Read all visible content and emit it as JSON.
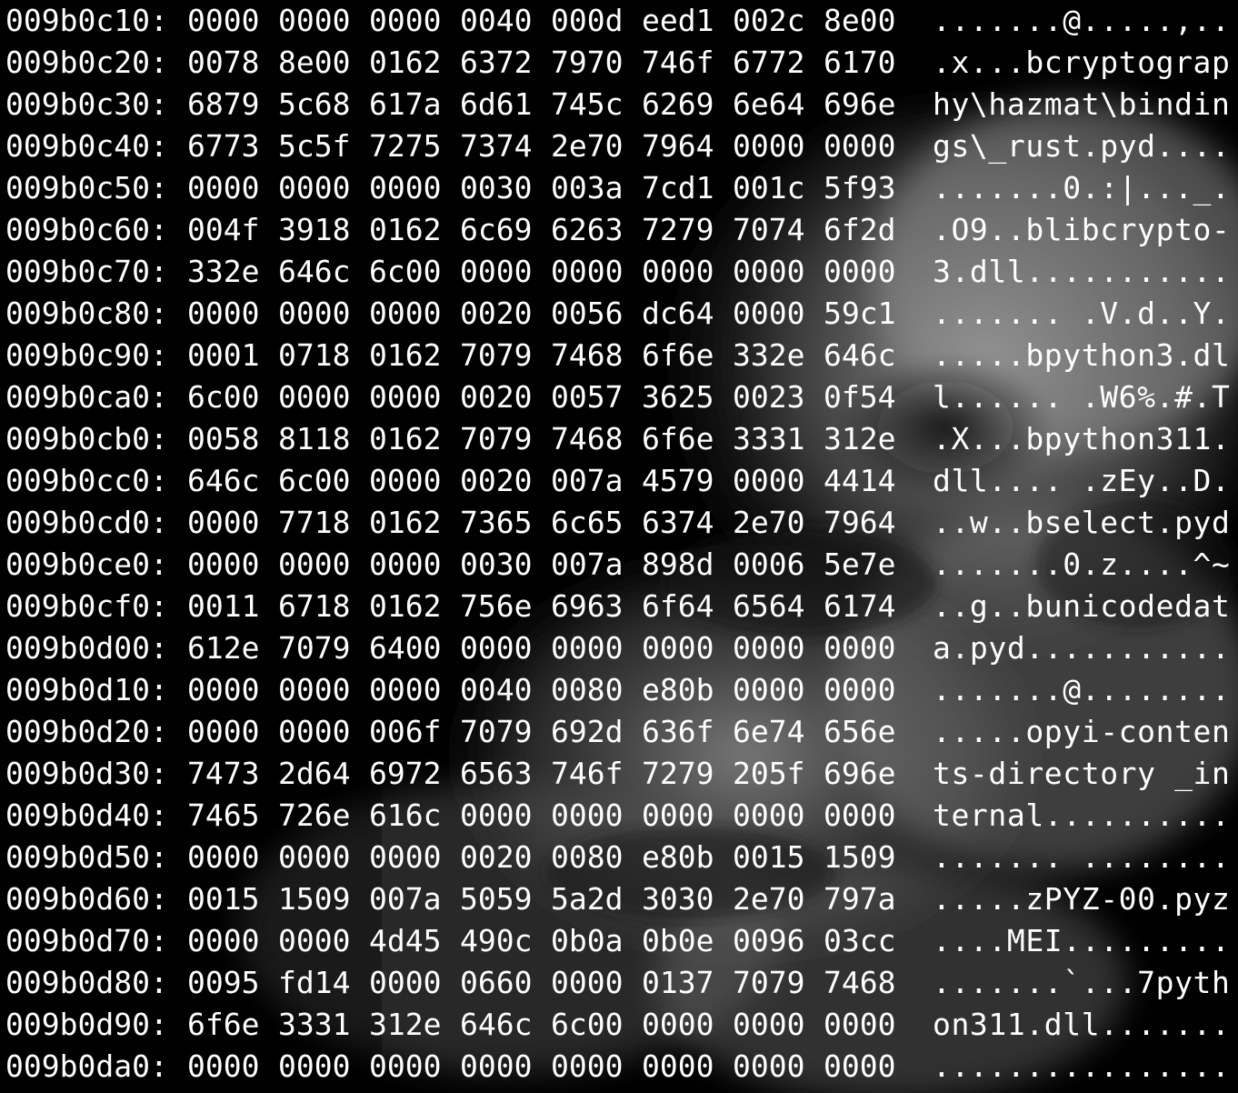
{
  "theme": {
    "background": "#000000",
    "foreground": "#ffffff",
    "wallpaper_tone": "#8a8a8a"
  },
  "rows": [
    {
      "addr": "009b0c10:",
      "hex": [
        "0000",
        "0000",
        "0000",
        "0040",
        "000d",
        "eed1",
        "002c",
        "8e00"
      ],
      "ascii": ".......@.....,.."
    },
    {
      "addr": "009b0c20:",
      "hex": [
        "0078",
        "8e00",
        "0162",
        "6372",
        "7970",
        "746f",
        "6772",
        "6170"
      ],
      "ascii": ".x...bcryptograp"
    },
    {
      "addr": "009b0c30:",
      "hex": [
        "6879",
        "5c68",
        "617a",
        "6d61",
        "745c",
        "6269",
        "6e64",
        "696e"
      ],
      "ascii": "hy\\hazmat\\bindin"
    },
    {
      "addr": "009b0c40:",
      "hex": [
        "6773",
        "5c5f",
        "7275",
        "7374",
        "2e70",
        "7964",
        "0000",
        "0000"
      ],
      "ascii": "gs\\_rust.pyd...."
    },
    {
      "addr": "009b0c50:",
      "hex": [
        "0000",
        "0000",
        "0000",
        "0030",
        "003a",
        "7cd1",
        "001c",
        "5f93"
      ],
      "ascii": ".......0.:|..._."
    },
    {
      "addr": "009b0c60:",
      "hex": [
        "004f",
        "3918",
        "0162",
        "6c69",
        "6263",
        "7279",
        "7074",
        "6f2d"
      ],
      "ascii": ".O9..blibcrypto-"
    },
    {
      "addr": "009b0c70:",
      "hex": [
        "332e",
        "646c",
        "6c00",
        "0000",
        "0000",
        "0000",
        "0000",
        "0000"
      ],
      "ascii": "3.dll..........."
    },
    {
      "addr": "009b0c80:",
      "hex": [
        "0000",
        "0000",
        "0000",
        "0020",
        "0056",
        "dc64",
        "0000",
        "59c1"
      ],
      "ascii": "....... .V.d..Y."
    },
    {
      "addr": "009b0c90:",
      "hex": [
        "0001",
        "0718",
        "0162",
        "7079",
        "7468",
        "6f6e",
        "332e",
        "646c"
      ],
      "ascii": ".....bpython3.dl"
    },
    {
      "addr": "009b0ca0:",
      "hex": [
        "6c00",
        "0000",
        "0000",
        "0020",
        "0057",
        "3625",
        "0023",
        "0f54"
      ],
      "ascii": "l...... .W6%.#.T"
    },
    {
      "addr": "009b0cb0:",
      "hex": [
        "0058",
        "8118",
        "0162",
        "7079",
        "7468",
        "6f6e",
        "3331",
        "312e"
      ],
      "ascii": ".X...bpython311."
    },
    {
      "addr": "009b0cc0:",
      "hex": [
        "646c",
        "6c00",
        "0000",
        "0020",
        "007a",
        "4579",
        "0000",
        "4414"
      ],
      "ascii": "dll.... .zEy..D."
    },
    {
      "addr": "009b0cd0:",
      "hex": [
        "0000",
        "7718",
        "0162",
        "7365",
        "6c65",
        "6374",
        "2e70",
        "7964"
      ],
      "ascii": "..w..bselect.pyd"
    },
    {
      "addr": "009b0ce0:",
      "hex": [
        "0000",
        "0000",
        "0000",
        "0030",
        "007a",
        "898d",
        "0006",
        "5e7e"
      ],
      "ascii": ".......0.z....^~"
    },
    {
      "addr": "009b0cf0:",
      "hex": [
        "0011",
        "6718",
        "0162",
        "756e",
        "6963",
        "6f64",
        "6564",
        "6174"
      ],
      "ascii": "..g..bunicodedat"
    },
    {
      "addr": "009b0d00:",
      "hex": [
        "612e",
        "7079",
        "6400",
        "0000",
        "0000",
        "0000",
        "0000",
        "0000"
      ],
      "ascii": "a.pyd..........."
    },
    {
      "addr": "009b0d10:",
      "hex": [
        "0000",
        "0000",
        "0000",
        "0040",
        "0080",
        "e80b",
        "0000",
        "0000"
      ],
      "ascii": ".......@........"
    },
    {
      "addr": "009b0d20:",
      "hex": [
        "0000",
        "0000",
        "006f",
        "7079",
        "692d",
        "636f",
        "6e74",
        "656e"
      ],
      "ascii": ".....opyi-conten"
    },
    {
      "addr": "009b0d30:",
      "hex": [
        "7473",
        "2d64",
        "6972",
        "6563",
        "746f",
        "7279",
        "205f",
        "696e"
      ],
      "ascii": "ts-directory _in"
    },
    {
      "addr": "009b0d40:",
      "hex": [
        "7465",
        "726e",
        "616c",
        "0000",
        "0000",
        "0000",
        "0000",
        "0000"
      ],
      "ascii": "ternal.........."
    },
    {
      "addr": "009b0d50:",
      "hex": [
        "0000",
        "0000",
        "0000",
        "0020",
        "0080",
        "e80b",
        "0015",
        "1509"
      ],
      "ascii": "....... ........"
    },
    {
      "addr": "009b0d60:",
      "hex": [
        "0015",
        "1509",
        "007a",
        "5059",
        "5a2d",
        "3030",
        "2e70",
        "797a"
      ],
      "ascii": ".....zPYZ-00.pyz"
    },
    {
      "addr": "009b0d70:",
      "hex": [
        "0000",
        "0000",
        "4d45",
        "490c",
        "0b0a",
        "0b0e",
        "0096",
        "03cc"
      ],
      "ascii": "....MEI........."
    },
    {
      "addr": "009b0d80:",
      "hex": [
        "0095",
        "fd14",
        "0000",
        "0660",
        "0000",
        "0137",
        "7079",
        "7468"
      ],
      "ascii": ".......`...7pyth"
    },
    {
      "addr": "009b0d90:",
      "hex": [
        "6f6e",
        "3331",
        "312e",
        "646c",
        "6c00",
        "0000",
        "0000",
        "0000"
      ],
      "ascii": "on311.dll......."
    },
    {
      "addr": "009b0da0:",
      "hex": [
        "0000",
        "0000",
        "0000",
        "0000",
        "0000",
        "0000",
        "0000",
        "0000"
      ],
      "ascii": "................"
    }
  ]
}
